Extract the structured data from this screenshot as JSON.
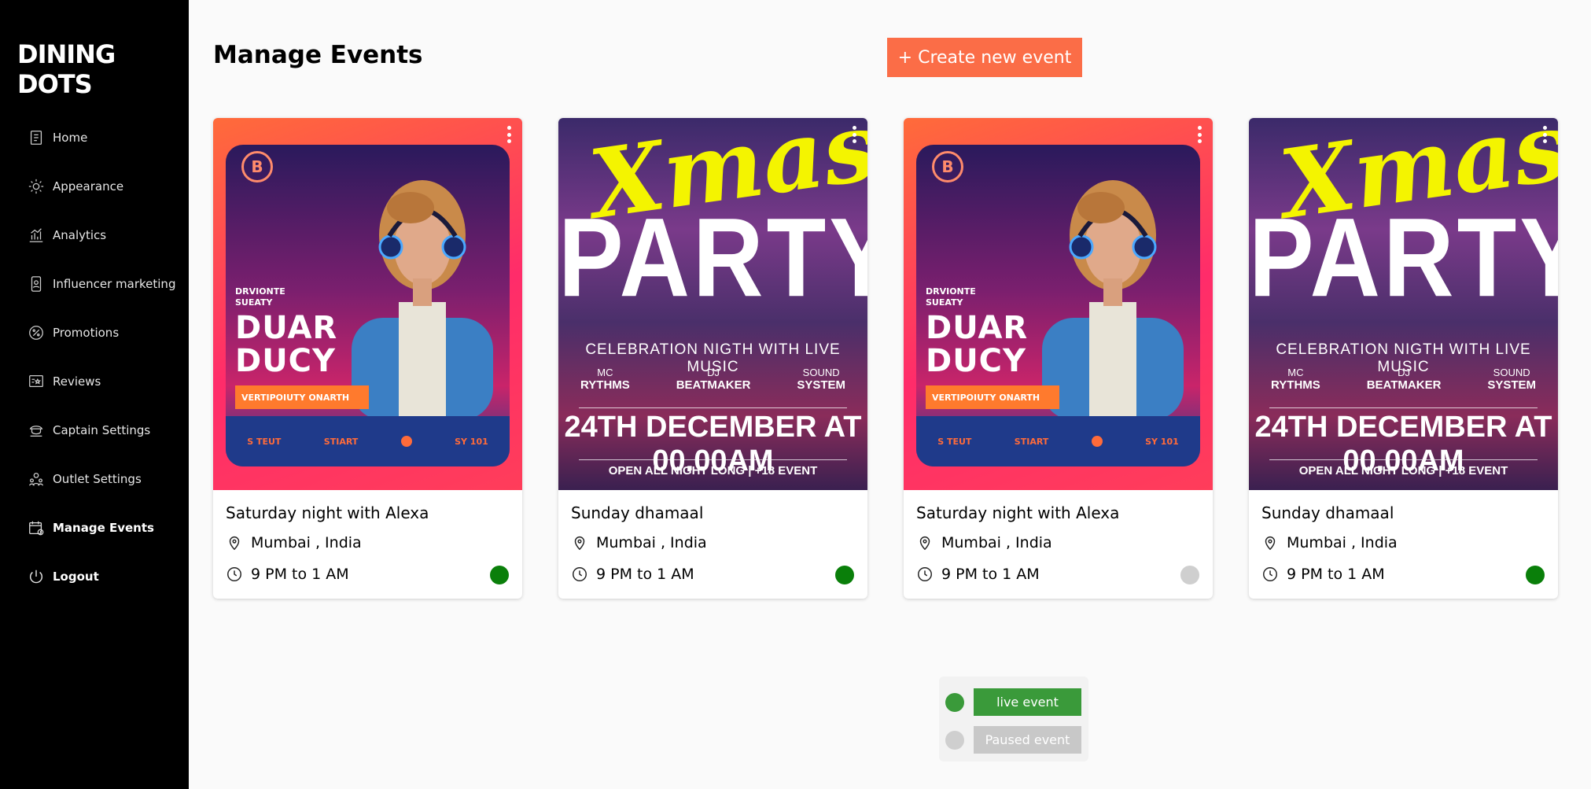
{
  "brand": {
    "logo": "DINING DOTS"
  },
  "sidebar": {
    "items": [
      {
        "label": "Home",
        "icon": "home-icon"
      },
      {
        "label": "Appearance",
        "icon": "appearance-icon"
      },
      {
        "label": "Analytics",
        "icon": "analytics-icon"
      },
      {
        "label": "Influencer marketing",
        "icon": "influencer-icon"
      },
      {
        "label": "Promotions",
        "icon": "promotions-icon"
      },
      {
        "label": "Reviews",
        "icon": "reviews-icon"
      },
      {
        "label": "Captain Settings",
        "icon": "captain-icon"
      },
      {
        "label": "Outlet Settings",
        "icon": "outlet-icon"
      },
      {
        "label": "Manage Events",
        "icon": "events-icon",
        "active": true
      },
      {
        "label": "Logout",
        "icon": "logout-icon"
      }
    ]
  },
  "header": {
    "title": "Manage Events",
    "create_button": "+ Create new event"
  },
  "events": [
    {
      "title": "Saturday night with Alexa",
      "location": "Mumbai , India",
      "time": "9 PM to 1 AM",
      "status": "live",
      "poster": "dj"
    },
    {
      "title": "Sunday dhamaal",
      "location": "Mumbai , India",
      "time": "9 PM to 1 AM",
      "status": "live",
      "poster": "xmas"
    },
    {
      "title": "Saturday night with Alexa",
      "location": "Mumbai , India",
      "time": "9 PM to 1 AM",
      "status": "paused",
      "poster": "dj"
    },
    {
      "title": "Sunday dhamaal",
      "location": "Mumbai , India",
      "time": "9 PM to 1 AM",
      "status": "live",
      "poster": "xmas"
    }
  ],
  "poster_dj": {
    "badge": "B",
    "small": [
      "DRVIONTE",
      "SUEATY"
    ],
    "big": [
      "DUAR",
      "DUCY"
    ],
    "bar": "VERTIPOIUTY ONARTH",
    "footer": [
      "S TEUT",
      "STIART",
      "SY 101"
    ]
  },
  "poster_xmas": {
    "script": "Xmas",
    "headline": "PARTY",
    "tagline": "CELEBRATION NIGTH WITH LIVE MUSIC",
    "roles": [
      {
        "top": "MC",
        "bottom": "RYTHMS"
      },
      {
        "top": "DJ",
        "bottom": "BEATMAKER"
      },
      {
        "top": "SOUND",
        "bottom": "SYSTEM"
      }
    ],
    "date": "24TH DECEMBER AT 00.00AM",
    "footer": "OPEN ALL NIGHT LONG | +18 EVENT"
  },
  "legend": {
    "live": "live event",
    "paused": "Paused event"
  },
  "colors": {
    "accent": "#fb6d47",
    "live": "#0a7f0a",
    "live_chip": "#3a9a3a",
    "paused": "#cfcfcf",
    "paused_chip": "#c8c8c8",
    "sidebar_bg": "#000000"
  }
}
